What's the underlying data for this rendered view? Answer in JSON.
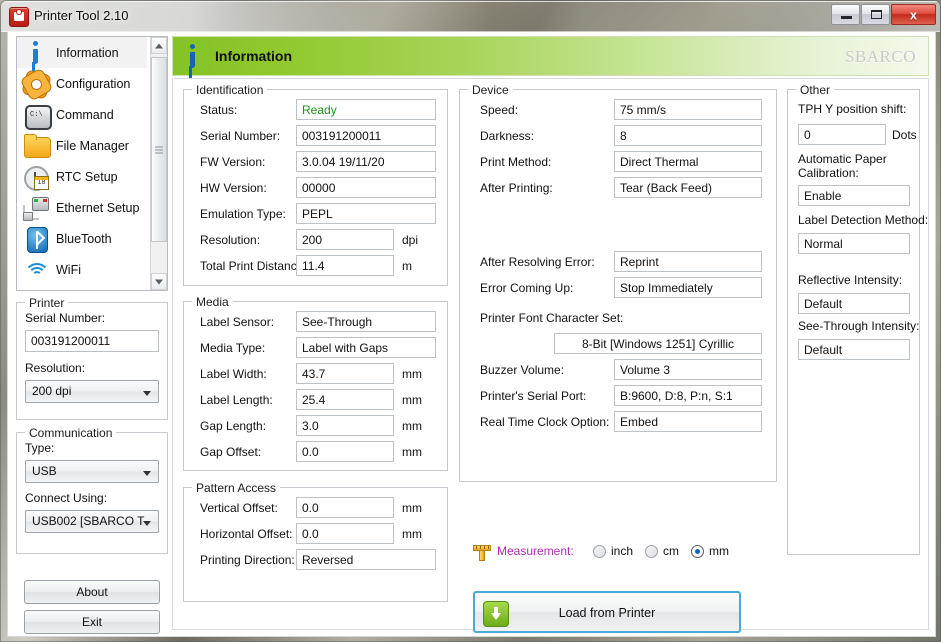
{
  "window": {
    "title": "Printer Tool 2.10",
    "icon": "printer-app-icon",
    "minimize_label": "Minimize",
    "maximize_label": "Maximize",
    "close_label": "x"
  },
  "sidebar": {
    "nav": [
      {
        "label": "Information",
        "icon": "info-icon",
        "selected": true
      },
      {
        "label": "Configuration",
        "icon": "gear-icon",
        "selected": false
      },
      {
        "label": "Command",
        "icon": "console-icon",
        "selected": false
      },
      {
        "label": "File Manager",
        "icon": "folder-icon",
        "selected": false
      },
      {
        "label": "RTC Setup",
        "icon": "clock-icon",
        "selected": false
      },
      {
        "label": "Ethernet Setup",
        "icon": "ethernet-icon",
        "selected": false
      },
      {
        "label": "BlueTooth",
        "icon": "bluetooth-icon",
        "selected": false
      },
      {
        "label": "WiFi",
        "icon": "wifi-icon",
        "selected": false
      }
    ],
    "printer": {
      "group_label": "Printer",
      "serial_label": "Serial Number:",
      "serial_value": "003191200011",
      "resolution_label": "Resolution:",
      "resolution_value": "200 dpi"
    },
    "communication": {
      "group_label": "Communication",
      "type_label": "Type:",
      "type_value": "USB",
      "connect_label": "Connect Using:",
      "connect_value": "USB002 [SBARCO T·"
    },
    "about_label": "About",
    "exit_label": "Exit"
  },
  "banner": {
    "title": "Information",
    "icon": "info-icon",
    "logo": "SBARCO"
  },
  "identification": {
    "group_label": "Identification",
    "fields": [
      {
        "label": "Status:",
        "value": "Ready",
        "unit": "",
        "status": true
      },
      {
        "label": "Serial Number:",
        "value": "003191200011",
        "unit": ""
      },
      {
        "label": "FW Version:",
        "value": "3.0.04 19/11/20",
        "unit": ""
      },
      {
        "label": "HW Version:",
        "value": "00000",
        "unit": ""
      },
      {
        "label": "Emulation Type:",
        "value": "PEPL",
        "unit": ""
      },
      {
        "label": "Resolution:",
        "value": "200",
        "unit": "dpi"
      },
      {
        "label": "Total Print Distance:",
        "value": "11.4",
        "unit": "m"
      }
    ]
  },
  "media": {
    "group_label": "Media",
    "fields": [
      {
        "label": "Label Sensor:",
        "value": "See-Through",
        "unit": ""
      },
      {
        "label": "Media Type:",
        "value": "Label with Gaps",
        "unit": ""
      },
      {
        "label": "Label Width:",
        "value": "43.7",
        "unit": "mm"
      },
      {
        "label": "Label Length:",
        "value": "25.4",
        "unit": "mm"
      },
      {
        "label": "Gap Length:",
        "value": "3.0",
        "unit": "mm"
      },
      {
        "label": "Gap Offset:",
        "value": "0.0",
        "unit": "mm"
      }
    ]
  },
  "pattern_access": {
    "group_label": "Pattern Access",
    "fields": [
      {
        "label": "Vertical Offset:",
        "value": "0.0",
        "unit": "mm"
      },
      {
        "label": "Horizontal Offset:",
        "value": "0.0",
        "unit": "mm"
      },
      {
        "label": "Printing Direction:",
        "value": "Reversed",
        "unit": ""
      }
    ]
  },
  "device": {
    "group_label": "Device",
    "fields": [
      {
        "label": "Speed:",
        "value": "75 mm/s"
      },
      {
        "label": "Darkness:",
        "value": "8"
      },
      {
        "label": "Print Method:",
        "value": "Direct Thermal"
      },
      {
        "label": "After Printing:",
        "value": "Tear (Back Feed)"
      },
      {
        "label": "After Resolving Error:",
        "value": "Reprint"
      },
      {
        "label": "Error Coming Up:",
        "value": "Stop Immediately"
      }
    ],
    "charset_label": "Printer Font Character Set:",
    "charset_value": "8-Bit [Windows 1251] Cyrillic",
    "tail_fields": [
      {
        "label": "Buzzer Volume:",
        "value": "Volume 3"
      },
      {
        "label": "Printer's Serial Port:",
        "value": "B:9600, D:8, P:n, S:1"
      },
      {
        "label": "Real Time Clock Option:",
        "value": "Embed"
      }
    ]
  },
  "other": {
    "group_label": "Other",
    "tph_label": "TPH Y position shift:",
    "tph_value": "0",
    "tph_unit": "Dots",
    "calibration_label": "Automatic Paper Calibration:",
    "calibration_value": "Enable",
    "detection_label": "Label Detection Method:",
    "detection_value": "Normal",
    "reflective_label": "Reflective Intensity:",
    "reflective_value": "Default",
    "seethrough_label": "See-Through Intensity:",
    "seethrough_value": "Default"
  },
  "measurement": {
    "icon": "ruler-icon",
    "label": "Measurement:",
    "options": [
      {
        "label": "inch",
        "selected": false
      },
      {
        "label": "cm",
        "selected": false
      },
      {
        "label": "mm",
        "selected": true
      }
    ]
  },
  "load_button": {
    "label": "Load from Printer",
    "icon": "download-icon"
  },
  "colors": {
    "banner_green": "#84c226",
    "status_ok": "#169416",
    "measurement_label": "#b02bb0",
    "accent_blue": "#4ba8d8",
    "close_red": "#c22b1b"
  }
}
